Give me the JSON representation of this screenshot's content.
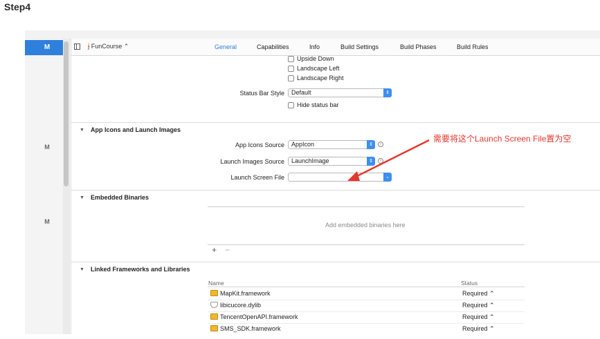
{
  "page": {
    "step_title": "Step4"
  },
  "left_pane": {
    "selected_label": "M",
    "m_labels": [
      "M",
      "M"
    ]
  },
  "tabbar": {
    "target": "FunCourse ⌃",
    "tabs": [
      {
        "label": "General",
        "active": true
      },
      {
        "label": "Capabilities"
      },
      {
        "label": "Info"
      },
      {
        "label": "Build Settings"
      },
      {
        "label": "Build Phases"
      },
      {
        "label": "Build Rules"
      }
    ]
  },
  "orientation": {
    "upside_down": "Upside Down",
    "landscape_left": "Landscape Left",
    "landscape_right": "Landscape Right"
  },
  "status_bar": {
    "style_label": "Status Bar Style",
    "style_value": "Default",
    "hide_label": "Hide status bar"
  },
  "app_icons_section": {
    "title": "App Icons and Launch Images",
    "icons_source_label": "App Icons Source",
    "icons_source_value": "AppIcon",
    "launch_images_label": "Launch Images Source",
    "launch_images_value": "LaunchImage",
    "launch_screen_label": "Launch Screen File",
    "launch_screen_value": ""
  },
  "embedded_section": {
    "title": "Embedded Binaries",
    "placeholder": "Add embedded binaries here",
    "plus": "+",
    "minus": "−"
  },
  "linked_section": {
    "title": "Linked Frameworks and Libraries",
    "col_name": "Name",
    "col_status": "Status",
    "rows": [
      {
        "name": "MapKit.framework",
        "status": "Required ⌃",
        "kind": "framework"
      },
      {
        "name": "libicucore.dylib",
        "status": "Required ⌃",
        "kind": "library"
      },
      {
        "name": "TencentOpenAPI.framework",
        "status": "Required ⌃",
        "kind": "framework"
      },
      {
        "name": "SMS_SDK.framework",
        "status": "Required ⌃",
        "kind": "framework"
      }
    ]
  },
  "annotation": {
    "text": "需要将这个Launch Screen File置为空",
    "color": "#e3382c"
  },
  "colors": {
    "accent": "#2f80dc",
    "popup_stepper": "#3c8ef0"
  }
}
